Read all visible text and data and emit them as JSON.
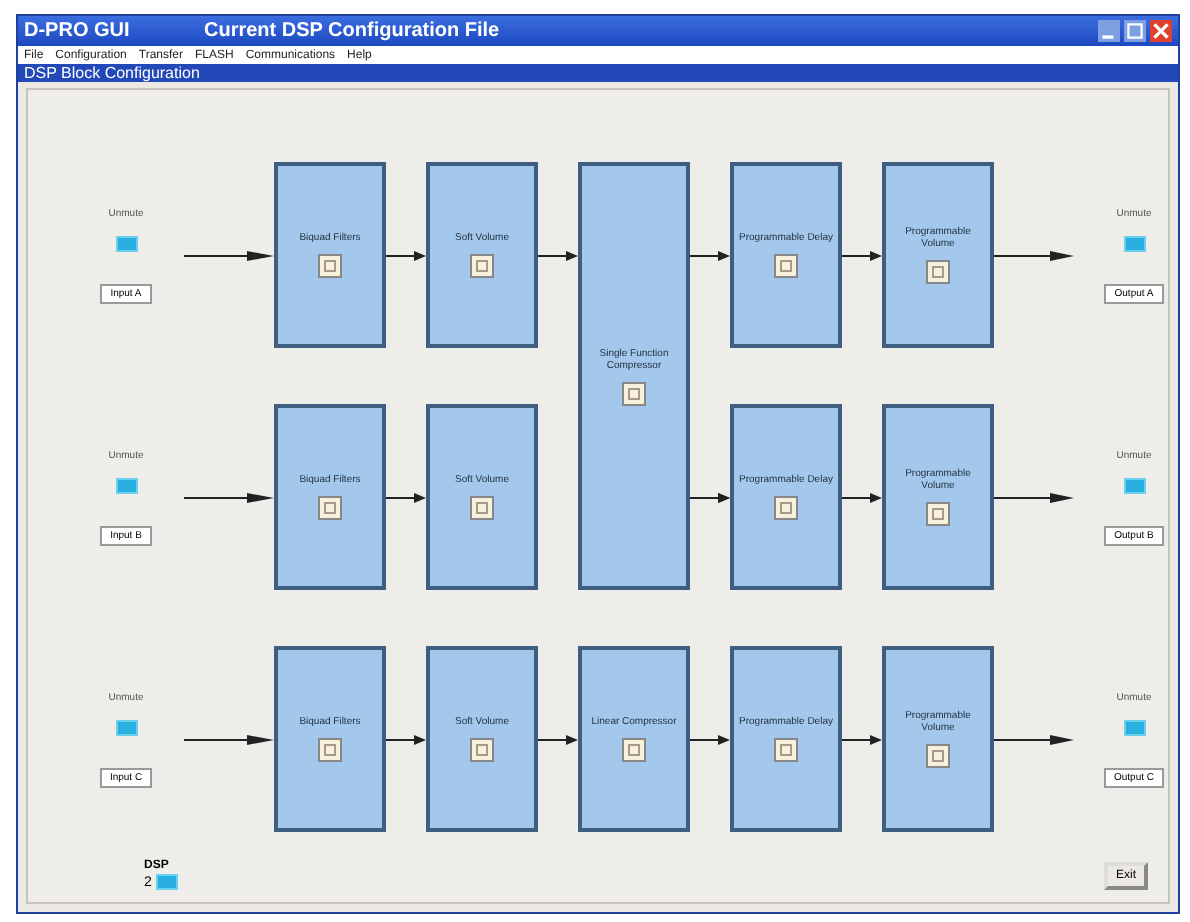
{
  "window": {
    "app": "D-PRO GUI",
    "title": "Current DSP Configuration File"
  },
  "menu": [
    "File",
    "Configuration",
    "Transfer",
    "FLASH",
    "Communications",
    "Help"
  ],
  "panel": {
    "title": "DSP Block Configuration"
  },
  "channels": [
    {
      "left_label": "Unmute",
      "left_on": true,
      "input": "Input A",
      "right_label": "Unmute",
      "right_on": true,
      "output": "Output A",
      "blocks": [
        {
          "label": "Biquad Filters",
          "kind": "stage"
        },
        {
          "label": "Soft Volume",
          "kind": "stage"
        },
        {
          "label": "Single Function Compressor",
          "kind": "tall"
        },
        {
          "label": "Programmable Delay",
          "kind": "stage"
        },
        {
          "label": "Programmable Volume",
          "kind": "stage"
        }
      ]
    },
    {
      "left_label": "Unmute",
      "left_on": true,
      "input": "Input B",
      "right_label": "Unmute",
      "right_on": true,
      "output": "Output B",
      "blocks": [
        {
          "label": "Biquad Filters",
          "kind": "stage"
        },
        {
          "label": "Soft Volume",
          "kind": "stage"
        },
        {
          "label": "Programmable Delay",
          "kind": "stage"
        },
        {
          "label": "Programmable Volume",
          "kind": "stage"
        }
      ]
    },
    {
      "left_label": "Unmute",
      "left_on": true,
      "input": "Input C",
      "right_label": "Unmute",
      "right_on": true,
      "output": "Output C",
      "blocks": [
        {
          "label": "Biquad Filters",
          "kind": "stage"
        },
        {
          "label": "Soft Volume",
          "kind": "stage"
        },
        {
          "label": "Linear Compressor",
          "kind": "stage"
        },
        {
          "label": "Programmable Delay",
          "kind": "stage"
        },
        {
          "label": "Programmable Volume",
          "kind": "stage"
        }
      ]
    }
  ],
  "dsp": {
    "label": "DSP",
    "value": "2",
    "on": true
  },
  "exit_button": "Exit"
}
